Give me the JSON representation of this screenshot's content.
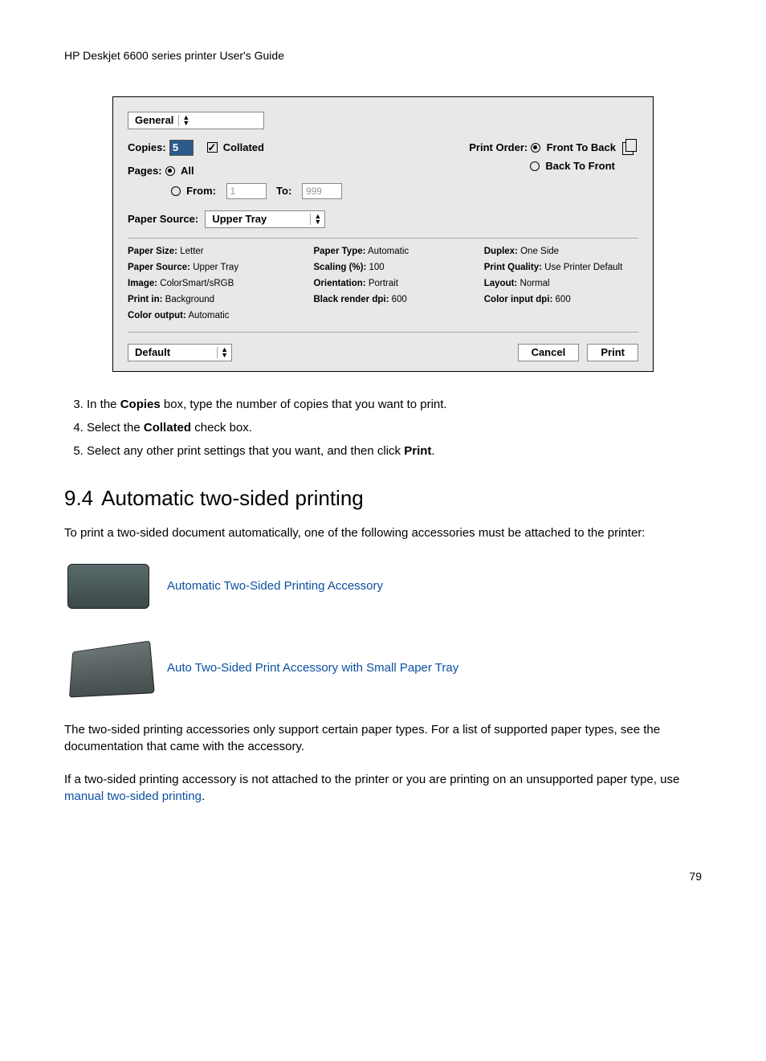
{
  "header": "HP Deskjet 6600 series printer User's Guide",
  "dialog": {
    "general_tab": "General",
    "copies_label": "Copies:",
    "copies_value": "5",
    "collated_label": "Collated",
    "print_order_label": "Print Order:",
    "front_to_back": "Front To Back",
    "back_to_front": "Back To Front",
    "pages_label": "Pages:",
    "all_label": "All",
    "from_label": "From:",
    "from_value": "1",
    "to_label": "To:",
    "to_value": "999",
    "paper_source_label": "Paper Source:",
    "paper_source_value": "Upper Tray",
    "settings": {
      "paper_size_l": "Paper Size:",
      "paper_size_v": "Letter",
      "paper_type_l": "Paper Type:",
      "paper_type_v": "Automatic",
      "duplex_l": "Duplex:",
      "duplex_v": "One Side",
      "paper_source_l": "Paper Source:",
      "paper_source_v": "Upper Tray",
      "scaling_l": "Scaling (%):",
      "scaling_v": "100",
      "print_quality_l": "Print Quality:",
      "print_quality_v": "Use Printer Default",
      "image_l": "Image:",
      "image_v": "ColorSmart/sRGB",
      "orientation_l": "Orientation:",
      "orientation_v": "Portrait",
      "layout_l": "Layout:",
      "layout_v": "Normal",
      "print_in_l": "Print in:",
      "print_in_v": "Background",
      "black_dpi_l": "Black render dpi:",
      "black_dpi_v": "600",
      "color_dpi_l": "Color input dpi:",
      "color_dpi_v": "600",
      "color_output_l": "Color output:",
      "color_output_v": "Automatic"
    },
    "default_label": "Default",
    "cancel_label": "Cancel",
    "print_label": "Print"
  },
  "steps": {
    "s3a": "In the ",
    "s3b": "Copies",
    "s3c": " box, type the number of copies that you want to print.",
    "s4a": "Select the ",
    "s4b": "Collated",
    "s4c": " check box.",
    "s5a": "Select any other print settings that you want, and then click ",
    "s5b": "Print",
    "s5c": "."
  },
  "section": {
    "num": "9.4",
    "title": "Automatic two-sided printing",
    "intro": "To print a two-sided document automatically, one of the following accessories must be attached to the printer:",
    "link1": "Automatic Two-Sided Printing Accessory",
    "link2": "Auto Two-Sided Print Accessory with Small Paper Tray",
    "para2": "The two-sided printing accessories only support certain paper types. For a list of supported paper types, see the documentation that came with the accessory.",
    "para3a": "If a two-sided printing accessory is not attached to the printer or you are printing on an unsupported paper type, use ",
    "para3_link": "manual two-sided printing",
    "para3b": "."
  },
  "page_number": "79"
}
